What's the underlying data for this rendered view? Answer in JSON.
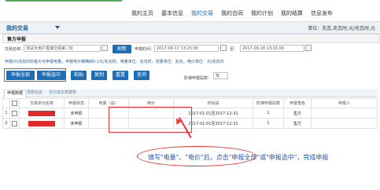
{
  "nav": {
    "items": [
      "我的主页",
      "基本信息",
      "我的交易",
      "我的合同",
      "我的计划",
      "我的结算",
      "信息发布"
    ],
    "active_index": 2
  },
  "subbar": {
    "title": "我的交易",
    "unit_text": "单位：兆瓦,兆瓦时,元/兆瓦时,元"
  },
  "panel": {
    "title": "售方申报"
  },
  "filter": {
    "trade_label": "交易名称：",
    "trade_value": "测试大用户直接交易第二轮",
    "refresh_label": "刷新",
    "start_label": "申报时间：",
    "start_value": "2017-08-17 13:15:00",
    "to_label": "至：",
    "end_value": "2017-08-18 13:15:00"
  },
  "notice": "申报(0)兆瓦时的最大可申报电量，申报电价精确到0.1元/兆瓦时，电量单位：兆瓦时，容量单位：兆瓦，电价单位：元/兆瓦时",
  "toolbar": {
    "buttons": [
      "申报全部",
      "申报选中",
      "粘贴",
      "复制",
      "重置",
      "查询"
    ],
    "direction_label": "阶梯申报段数：",
    "direction_value": "无"
  },
  "tabs": [
    {
      "label": "申报数据",
      "active": true
    },
    {
      "label": "限额信息",
      "active": false
    },
    {
      "label": "单元成本数据表",
      "active": false
    }
  ],
  "table": {
    "headers": [
      "",
      "",
      "交易单元名称",
      "申报状态",
      "电量（总）",
      "电价",
      "时间段",
      "阶梯申报段数",
      "申报角色",
      "申报人"
    ],
    "rows": [
      {
        "index": "1",
        "status": "未申报",
        "energy": "",
        "price": "",
        "period": "2017-01-01至2017-12-31",
        "steps": "1",
        "role": "售方",
        "user": ""
      },
      {
        "index": "2",
        "status": "未申报",
        "energy": "",
        "price": "",
        "period": "2017-01-01至2017-12-31",
        "steps": "1",
        "role": "售方",
        "user": ""
      }
    ]
  },
  "annotation": {
    "text": "填写\"电量\"、\"电价\"后，点击\"申报全部\"或\"申报选中\"，完成申报"
  },
  "colors": {
    "primary_button": "#1d6eb5",
    "highlight": "#e33333",
    "annotation_text": "#2255b0",
    "redaction": "#e02b2b"
  }
}
